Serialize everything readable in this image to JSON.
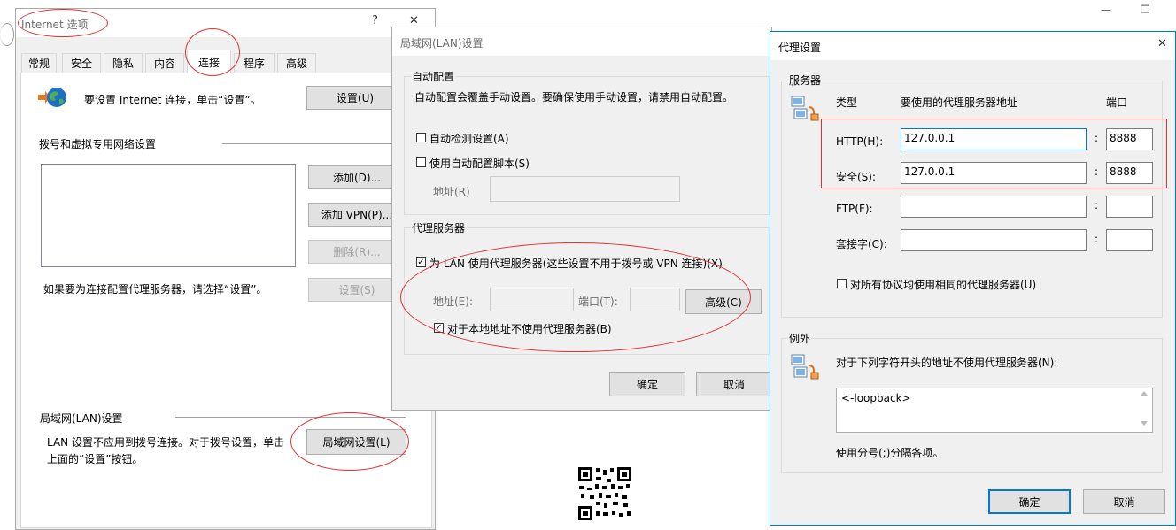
{
  "internet_options": {
    "title": "Internet 选项",
    "help": "?",
    "close": "✕",
    "tabs": [
      "常规",
      "安全",
      "隐私",
      "内容",
      "连接",
      "程序",
      "高级"
    ],
    "setup_text": "要设置 Internet 连接，单击“设置”。",
    "setup_button": "设置(U)",
    "dialup_heading": "拨号和虚拟专用网络设置",
    "add_button": "添加(D)...",
    "add_vpn_button": "添加 VPN(P)...",
    "remove_button": "删除(R)...",
    "proxy_hint": "如果要为连接配置代理服务器，请选择“设置”。",
    "settings_button": "设置(S)",
    "lan_heading": "局域网(LAN)设置",
    "lan_text_1": "LAN 设置不应用到拨号连接。对于拨号设置，单击",
    "lan_text_2": "上面的“设置”按钮。",
    "lan_button": "局域网设置(L)"
  },
  "lan_settings": {
    "title": "局域网(LAN)设置",
    "auto_group": "自动配置",
    "auto_desc": "自动配置会覆盖手动设置。要确保使用手动设置，请禁用自动配置。",
    "auto_detect": "自动检测设置(A)",
    "auto_detect_checked": false,
    "use_script": "使用自动配置脚本(S)",
    "use_script_checked": false,
    "address_label": "地址(R)",
    "proxy_group": "代理服务器",
    "use_proxy": "为 LAN 使用代理服务器(这些设置不用于拨号或 VPN 连接)(X)",
    "use_proxy_checked": true,
    "proxy_address_label": "地址(E):",
    "proxy_port_label": "端口(T):",
    "advanced_button": "高级(C)",
    "bypass_local": "对于本地地址不使用代理服务器(B)",
    "bypass_local_checked": true,
    "ok": "确定",
    "cancel": "取消"
  },
  "proxy_settings": {
    "title": "代理设置",
    "close": "✕",
    "servers_group": "服务器",
    "col_type": "类型",
    "col_address": "要使用的代理服务器地址",
    "col_port": "端口",
    "rows": [
      {
        "label": "HTTP(H):",
        "address": "127.0.0.1",
        "port": "8888"
      },
      {
        "label": "安全(S):",
        "address": "127.0.0.1",
        "port": "8888"
      },
      {
        "label": "FTP(F):",
        "address": "",
        "port": ""
      },
      {
        "label": "套接字(C):",
        "address": "",
        "port": ""
      }
    ],
    "colon": ":",
    "same_proxy": "对所有协议均使用相同的代理服务器(U)",
    "same_proxy_checked": false,
    "exceptions_group": "例外",
    "exceptions_desc": "对于下列字符开头的地址不使用代理服务器(N):",
    "exceptions_value": "<-loopback>",
    "separator_hint": "使用分号(;)分隔各项。",
    "ok": "确定",
    "cancel": "取消"
  },
  "background": {
    "minimize": "—",
    "restore": "❐"
  },
  "colors": {
    "annotation": "#e03030",
    "focus": "#0078d7",
    "dialog": "#f0f0f0"
  }
}
